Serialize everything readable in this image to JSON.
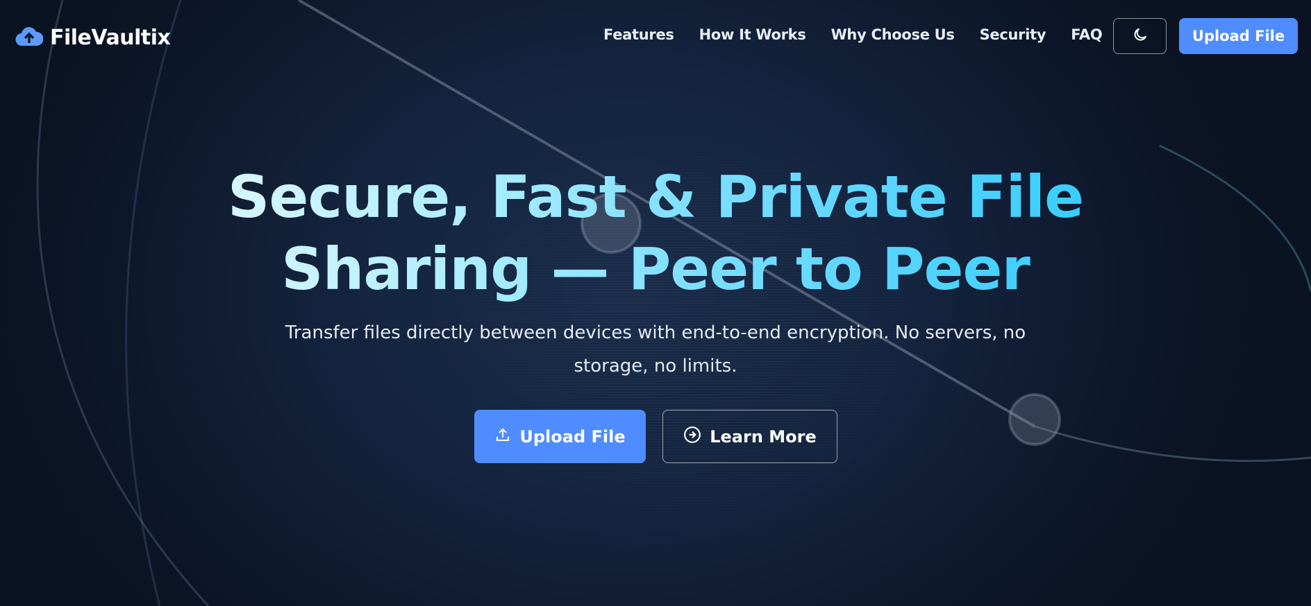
{
  "brand": {
    "name": "FileVaultix",
    "logo_icon": "cloud-upload-icon",
    "accent": "#4f8cff"
  },
  "nav": {
    "links": [
      "Features",
      "How It Works",
      "Why Choose Us",
      "Security",
      "FAQ"
    ],
    "theme_icon": "moon-icon",
    "upload_label": "Upload File"
  },
  "hero": {
    "title_line1": "Secure, Fast & Private File",
    "title_line2": "Sharing — Peer to Peer",
    "subtitle": "Transfer files directly between devices with end-to-end encryption. No servers, no storage, no limits.",
    "primary_label": "Upload File",
    "primary_icon": "upload-icon",
    "secondary_label": "Learn More",
    "secondary_icon": "arrow-circle-right-icon",
    "gradient": [
      "#ffffff",
      "#12c6ff"
    ]
  }
}
